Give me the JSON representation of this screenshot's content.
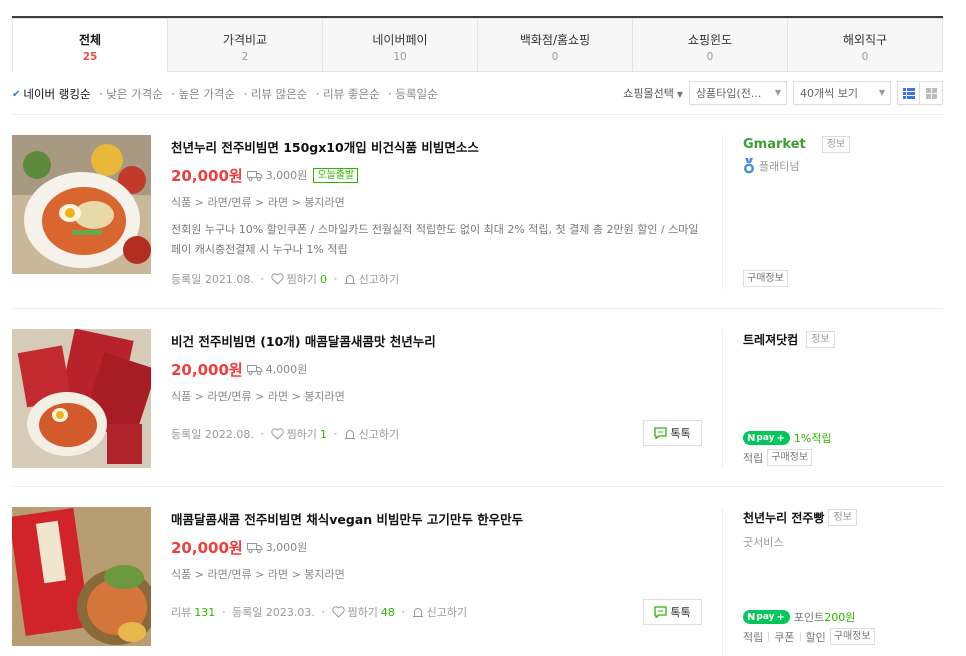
{
  "tabs": [
    {
      "label": "전체",
      "count": "25"
    },
    {
      "label": "가격비교",
      "count": "2"
    },
    {
      "label": "네이버페이",
      "count": "10"
    },
    {
      "label": "백화점/홈쇼핑",
      "count": "0"
    },
    {
      "label": "쇼핑윈도",
      "count": "0"
    },
    {
      "label": "해외직구",
      "count": "0"
    }
  ],
  "sort": {
    "options": [
      "네이버 랭킹순",
      "낮은 가격순",
      "높은 가격순",
      "리뷰 많은순",
      "리뷰 좋은순",
      "등록일순"
    ],
    "mall_select": "쇼핑몰선택",
    "product_type": "상품타입(전...",
    "page_size": "40개씩 보기"
  },
  "items": [
    {
      "title": "천년누리 전주비빔면 150gx10개입 비건식품 비빔면소스",
      "price": "20,000원",
      "shipping": "3,000원",
      "today_badge": "오늘출발",
      "category": "식품 > 라면/면류 > 라면 > 봉지라면",
      "desc": "전회원 누구나 10% 할인쿠폰 / 스마일카드 전월실적 적립한도 없이 최대 2% 적립, 첫 결제 총 2만원 할인 / 스마일페이 캐시충전결제 시 누구나 1% 적립",
      "reg_date": "등록일 2021.08.",
      "zzim_label": "찜하기",
      "zzim_count": "0",
      "report_label": "신고하기",
      "mall_logo": "Gmarket",
      "mall_info": "정보",
      "mall_grade": "플래티넘",
      "buy_info": "구매정보"
    },
    {
      "title": "비건 전주비빔면 (10개) 매콤달콤새콤맛 천년누리",
      "price": "20,000원",
      "shipping": "4,000원",
      "category": "식품 > 라면/면류 > 라면 > 봉지라면",
      "reg_date": "등록일 2022.08.",
      "zzim_label": "찜하기",
      "zzim_count": "1",
      "report_label": "신고하기",
      "talk_label": "톡톡",
      "mall_name": "트레져닷컴",
      "mall_info": "정보",
      "npay_label": "pay",
      "npay_benefit": "1%적립",
      "benefit_1": "적립",
      "buy_info": "구매정보"
    },
    {
      "title": "매콤달콤새콤 전주비빔면 채식vegan 비빔만두 고기만두 한우만두",
      "price": "20,000원",
      "shipping": "3,000원",
      "category": "식품 > 라면/면류 > 라면 > 봉지라면",
      "review_label": "리뷰",
      "review_count": "131",
      "reg_date": "등록일 2023.03.",
      "zzim_label": "찜하기",
      "zzim_count": "48",
      "report_label": "신고하기",
      "talk_label": "톡톡",
      "mall_name": "천년누리 전주빵",
      "mall_info": "정보",
      "good_service": "굿서비스",
      "npay_label": "pay",
      "npay_point_label": "포인트",
      "npay_point_value": "200원",
      "benefit_1": "적립",
      "benefit_2": "쿠폰",
      "benefit_3": "할인",
      "buy_info": "구매정보"
    }
  ],
  "colors": {
    "price": "#f03d3d",
    "active_count": "#f04b4b",
    "npay_green": "#03c75a",
    "benefit_green": "#2db400",
    "check_blue": "#3b73e8"
  }
}
